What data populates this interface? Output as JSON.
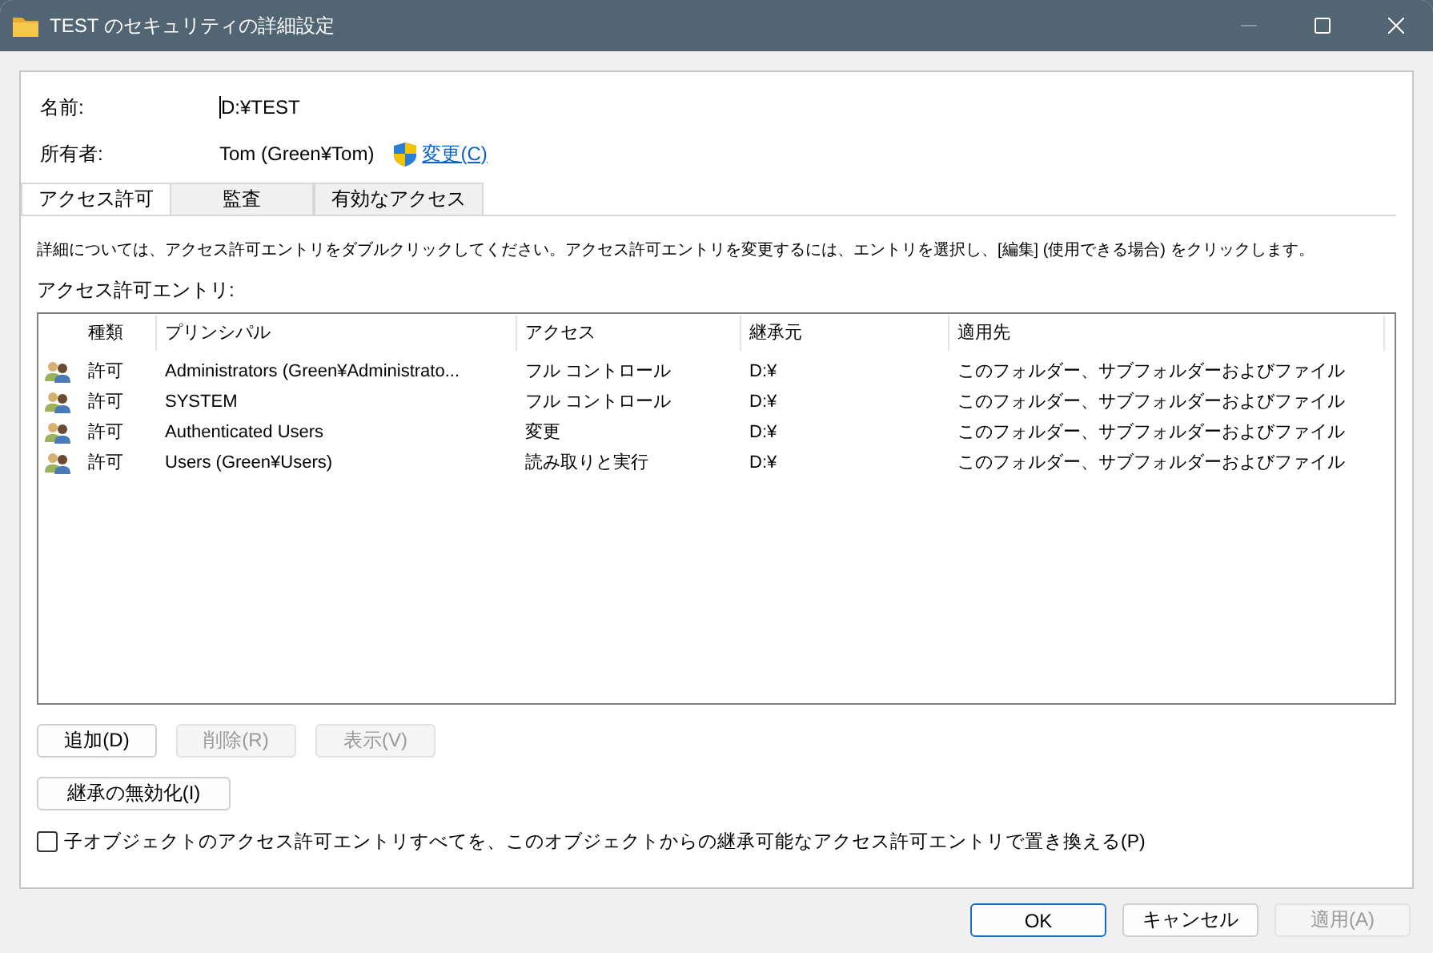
{
  "window": {
    "title": "TEST のセキュリティの詳細設定"
  },
  "name": {
    "label": "名前:",
    "value": "D:¥TEST"
  },
  "owner": {
    "label": "所有者:",
    "value": "Tom (Green¥Tom)",
    "link": "変更(C)"
  },
  "tabs": [
    {
      "label": "アクセス許可",
      "selected": true
    },
    {
      "label": "監査",
      "selected": false
    },
    {
      "label": "有効なアクセス",
      "selected": false
    }
  ],
  "description": "詳細については、アクセス許可エントリをダブルクリックしてください。アクセス許可エントリを変更するには、エントリを選択し、[編集] (使用できる場合) をクリックします。",
  "list_label": "アクセス許可エントリ:",
  "table": {
    "columns": [
      "種類",
      "プリンシパル",
      "アクセス",
      "継承元",
      "適用先"
    ],
    "rows": [
      {
        "cells": [
          "許可",
          "Administrators (Green¥Administrato...",
          "フル コントロール",
          "D:¥",
          "このフォルダー、サブフォルダーおよびファイル"
        ]
      },
      {
        "cells": [
          "許可",
          "SYSTEM",
          "フル コントロール",
          "D:¥",
          "このフォルダー、サブフォルダーおよびファイル"
        ]
      },
      {
        "cells": [
          "許可",
          "Authenticated Users",
          "変更",
          "D:¥",
          "このフォルダー、サブフォルダーおよびファイル"
        ]
      },
      {
        "cells": [
          "許可",
          "Users (Green¥Users)",
          "読み取りと実行",
          "D:¥",
          "このフォルダー、サブフォルダーおよびファイル"
        ]
      }
    ]
  },
  "entry_buttons": [
    {
      "label": "追加(D)",
      "disabled": false
    },
    {
      "label": "削除(R)",
      "disabled": true
    },
    {
      "label": "表示(V)",
      "disabled": true
    }
  ],
  "inherit_button": {
    "label": "継承の無効化(I)",
    "disabled": false
  },
  "replace_checkbox": {
    "label": "子オブジェクトのアクセス許可エントリすべてを、このオブジェクトからの継承可能なアクセス許可エントリで置き換える(P)",
    "checked": false
  },
  "dialog_buttons": [
    {
      "label": "OK",
      "disabled": false,
      "default": true
    },
    {
      "label": "キャンセル",
      "disabled": false,
      "default": false
    },
    {
      "label": "適用(A)",
      "disabled": true,
      "default": false
    }
  ]
}
